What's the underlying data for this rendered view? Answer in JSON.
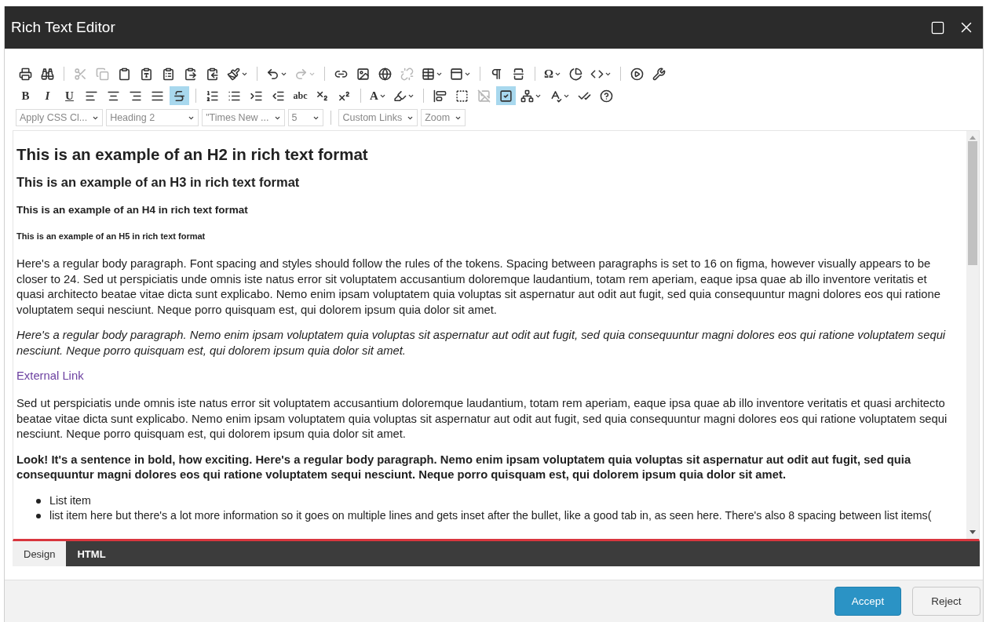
{
  "window": {
    "title": "Rich Text Editor"
  },
  "toolbar": {
    "rows": [
      [
        {
          "kind": "button",
          "disabled": false,
          "active": false
        },
        {
          "kind": "button",
          "disabled": false,
          "active": false
        },
        {
          "kind": "separator"
        },
        {
          "kind": "button",
          "disabled": true,
          "active": false
        },
        {
          "kind": "button",
          "disabled": true,
          "active": false
        },
        {
          "kind": "button",
          "disabled": false,
          "active": false
        },
        {
          "kind": "button",
          "disabled": false,
          "active": false
        },
        {
          "kind": "button",
          "disabled": false,
          "active": false
        },
        {
          "kind": "button",
          "disabled": false,
          "active": false
        },
        {
          "kind": "button",
          "disabled": false,
          "active": false
        },
        {
          "kind": "dropdown",
          "disabled": false,
          "active": false
        },
        {
          "kind": "separator"
        },
        {
          "kind": "dropdown",
          "disabled": false,
          "active": false
        },
        {
          "kind": "dropdown",
          "disabled": true,
          "active": false
        },
        {
          "kind": "separator"
        },
        {
          "kind": "button",
          "disabled": false,
          "active": false
        },
        {
          "kind": "button",
          "disabled": false,
          "active": false
        },
        {
          "kind": "button",
          "disabled": false,
          "active": false
        },
        {
          "kind": "button",
          "disabled": true,
          "active": false
        },
        {
          "kind": "dropdown",
          "disabled": false,
          "active": false
        },
        {
          "kind": "dropdown",
          "disabled": false,
          "active": false
        },
        {
          "kind": "separator"
        },
        {
          "kind": "button",
          "disabled": false,
          "active": false
        },
        {
          "kind": "button",
          "disabled": false,
          "active": false
        },
        {
          "kind": "separator"
        },
        {
          "kind": "dropdown",
          "disabled": false,
          "active": false,
          "label": "Ω"
        },
        {
          "kind": "button",
          "disabled": false,
          "active": false
        },
        {
          "kind": "dropdown",
          "disabled": false,
          "active": false
        },
        {
          "kind": "separator"
        },
        {
          "kind": "button",
          "disabled": false,
          "active": false
        },
        {
          "kind": "button",
          "disabled": false,
          "active": false
        }
      ],
      [
        {
          "kind": "button",
          "disabled": false,
          "active": false,
          "label": "B"
        },
        {
          "kind": "button",
          "disabled": false,
          "active": false,
          "label": "I"
        },
        {
          "kind": "button",
          "disabled": false,
          "active": false,
          "label": "U"
        },
        {
          "kind": "button",
          "disabled": false,
          "active": false
        },
        {
          "kind": "button",
          "disabled": false,
          "active": false
        },
        {
          "kind": "button",
          "disabled": false,
          "active": false
        },
        {
          "kind": "button",
          "disabled": false,
          "active": false
        },
        {
          "kind": "button",
          "disabled": false,
          "active": true
        },
        {
          "kind": "separator"
        },
        {
          "kind": "button",
          "disabled": false,
          "active": false
        },
        {
          "kind": "button",
          "disabled": false,
          "active": false
        },
        {
          "kind": "button",
          "disabled": false,
          "active": false
        },
        {
          "kind": "button",
          "disabled": false,
          "active": false
        },
        {
          "kind": "button",
          "disabled": false,
          "active": false,
          "label": "abc"
        },
        {
          "kind": "button",
          "disabled": false,
          "active": false
        },
        {
          "kind": "button",
          "disabled": false,
          "active": false
        },
        {
          "kind": "separator"
        },
        {
          "kind": "dropdown",
          "disabled": false,
          "active": false,
          "label": "A"
        },
        {
          "kind": "dropdown",
          "disabled": false,
          "active": false
        },
        {
          "kind": "separator"
        },
        {
          "kind": "button",
          "disabled": false,
          "active": false
        },
        {
          "kind": "button",
          "disabled": false,
          "active": false
        },
        {
          "kind": "button",
          "disabled": true,
          "active": false
        },
        {
          "kind": "button",
          "disabled": false,
          "active": true
        },
        {
          "kind": "dropdown",
          "disabled": false,
          "active": false
        },
        {
          "kind": "dropdown",
          "disabled": false,
          "active": false
        },
        {
          "kind": "button",
          "disabled": false,
          "active": false
        },
        {
          "kind": "button",
          "disabled": false,
          "active": false
        }
      ]
    ],
    "selects": [
      {
        "kind": "select",
        "value": "Apply CSS Cl..."
      },
      {
        "kind": "select",
        "value": "Heading 2"
      },
      {
        "kind": "select",
        "value": "\"Times New ..."
      },
      {
        "kind": "select",
        "value": "5"
      },
      {
        "kind": "separator"
      },
      {
        "kind": "select",
        "value": "Custom Links"
      },
      {
        "kind": "select",
        "value": "Zoom"
      }
    ]
  },
  "content": [
    {
      "kind": "h2",
      "text": "This is an example of an H2 in rich text format"
    },
    {
      "kind": "h3",
      "text": "This is an example of an H3 in rich text format"
    },
    {
      "kind": "h4",
      "text": "This is an example of an H4 in rich text format"
    },
    {
      "kind": "h5",
      "text": "This is an example of an H5 in rich text format"
    },
    {
      "kind": "p",
      "text": "Here's a regular body paragraph. Font spacing and styles should follow the rules of the tokens. Spacing between paragraphs is set to 16 on figma, however visually appears to be closer to 24. Sed ut perspiciatis unde omnis iste natus error sit voluptatem accusantium doloremque laudantium, totam rem aperiam, eaque ipsa quae ab illo inventore veritatis et quasi architecto beatae vitae dicta sunt explicabo. Nemo enim ipsam voluptatem quia voluptas sit aspernatur aut odit aut fugit, sed quia consequuntur magni dolores eos qui ratione voluptatem sequi nesciunt. Neque porro quisquam est, qui dolorem ipsum quia dolor sit amet."
    },
    {
      "kind": "italic",
      "text": "Here's a regular body paragraph. Nemo enim ipsam voluptatem quia voluptas sit aspernatur aut odit aut fugit, sed quia consequuntur magni dolores eos qui ratione voluptatem sequi nesciunt. Neque porro quisquam est, qui dolorem ipsum quia dolor sit amet."
    },
    {
      "kind": "link",
      "text": "External Link"
    },
    {
      "kind": "p",
      "text": "Sed ut perspiciatis unde omnis iste natus error sit voluptatem accusantium doloremque laudantium, totam rem aperiam, eaque ipsa quae ab illo inventore veritatis et quasi architecto beatae vitae dicta sunt explicabo. Nemo enim ipsam voluptatem quia voluptas sit aspernatur aut odit aut fugit, sed quia consequuntur magni dolores eos qui ratione voluptatem sequi nesciunt. Neque porro quisquam est, qui dolorem ipsum quia dolor sit amet."
    },
    {
      "kind": "bold",
      "text": "Look! It's a sentence in bold, how exciting. Here's a regular body paragraph. Nemo enim ipsam voluptatem quia voluptas sit aspernatur aut odit aut fugit, sed quia consequuntur magni dolores eos qui ratione voluptatem sequi nesciunt. Neque porro quisquam est, qui dolorem ipsum quia dolor sit amet."
    },
    {
      "kind": "list",
      "items": [
        "List item",
        "list item here but there's a lot more information so it goes on multiple lines and gets inset after the bullet, like a good tab in, as seen here. There's also 8 spacing between list items("
      ]
    }
  ],
  "view_tabs": [
    {
      "label": "Design",
      "selected": true
    },
    {
      "label": "HTML",
      "selected": false
    }
  ],
  "buttons": [
    {
      "label": "Accept",
      "kind": "primary"
    },
    {
      "label": "Reject",
      "kind": "secondary"
    }
  ]
}
